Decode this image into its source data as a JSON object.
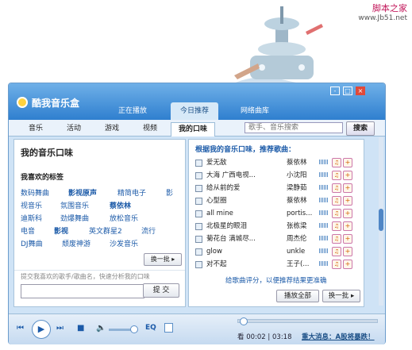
{
  "watermark": {
    "line1": "脚本之家",
    "line2": "www.Jb51.net"
  },
  "window": {
    "title": "酷我音乐盒",
    "tabs": [
      "正在播放",
      "今日推荐",
      "网络曲库"
    ],
    "controls": [
      "-",
      "□",
      "×"
    ]
  },
  "category_tabs": [
    "音乐",
    "活动",
    "游戏",
    "视频",
    "我的口味"
  ],
  "search": {
    "placeholder": "歌手、音乐搜索",
    "button": "搜索"
  },
  "left_panel": {
    "title": "我的音乐口味",
    "tags_title": "我喜欢的标签",
    "tags": [
      {
        "text": "数码舞曲",
        "bold": false
      },
      {
        "text": "影视原声",
        "bold": true
      },
      {
        "text": "精简电子",
        "bold": false
      },
      {
        "text": "影",
        "bold": false
      },
      {
        "text": "视音乐",
        "bold": false
      },
      {
        "text": "氛围音乐",
        "bold": false
      },
      {
        "text": "蔡依林",
        "bold": true
      },
      {
        "text": "迪斯科",
        "bold": false
      },
      {
        "text": "劲爆舞曲",
        "bold": false
      },
      {
        "text": "放松音乐",
        "bold": false
      },
      {
        "text": "电音",
        "bold": false
      },
      {
        "text": "影视",
        "bold": true
      },
      {
        "text": "英文群星2",
        "bold": false
      },
      {
        "text": "流行",
        "bold": false
      },
      {
        "text": "DJ舞曲",
        "bold": false
      },
      {
        "text": "颓废神游",
        "bold": false
      },
      {
        "text": "沙发音乐",
        "bold": false
      }
    ],
    "refresh_button": "换一批",
    "hint": "提交我喜欢的歌手/歌曲名，快速分析我的口味",
    "submit_button": "提 交"
  },
  "right_panel": {
    "title": "根据我的音乐口味，推荐歌曲：",
    "songs": [
      {
        "name": "爱无敌",
        "singer": "蔡依林"
      },
      {
        "name": "大海 广西电视...",
        "singer": "小沈阳"
      },
      {
        "name": "给从前的爱",
        "singer": "梁静茹"
      },
      {
        "name": "心型圈",
        "singer": "蔡依林"
      },
      {
        "name": "all mine",
        "singer": "portis..."
      },
      {
        "name": "北极星的眼泪",
        "singer": "张栋梁"
      },
      {
        "name": "菊花台 满城尽...",
        "singer": "周杰伦"
      },
      {
        "name": "glow",
        "singer": "unkle"
      },
      {
        "name": "对不起",
        "singer": "王子(..."
      }
    ],
    "rate_link": "给歌曲评分，以便推荐结果更准确",
    "play_all_button": "播放全部",
    "refresh_button": "换一批"
  },
  "player": {
    "current_time": "00:02",
    "total_time": "03:18",
    "progress": 0.01,
    "volume": 0.85,
    "eq_label": "EQ",
    "news": "重大消息：A股将暴跌！",
    "time_prefix": "看"
  }
}
